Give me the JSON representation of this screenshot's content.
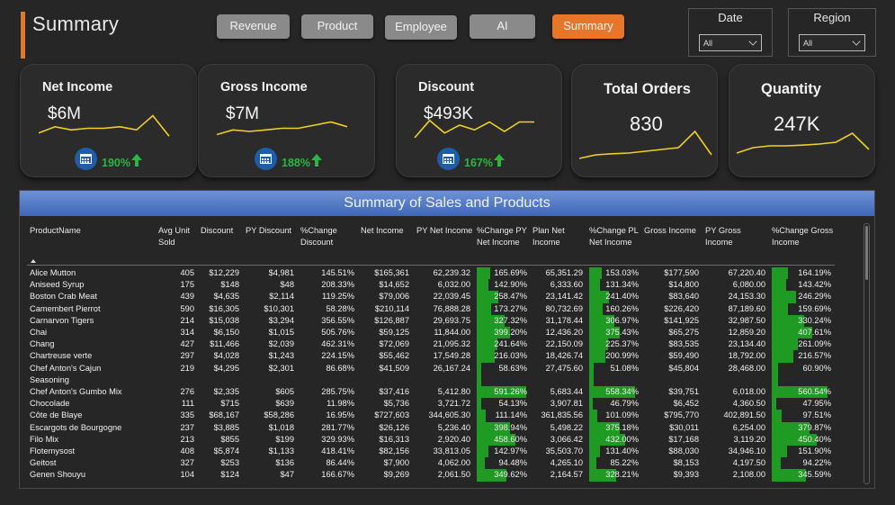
{
  "header": {
    "title": "Summary"
  },
  "nav": [
    {
      "label": "Revenue",
      "active": false
    },
    {
      "label": "Product",
      "active": false
    },
    {
      "label": "Employee",
      "active": false
    },
    {
      "label": "AI",
      "active": false
    },
    {
      "label": "Summary",
      "active": true
    }
  ],
  "slicers": {
    "date": {
      "label": "Date",
      "value": "All"
    },
    "region": {
      "label": "Region",
      "value": "All"
    }
  },
  "cards": [
    {
      "title": "Net Income",
      "value": "$6M",
      "kpi": "190%",
      "icon": "calendar-icon",
      "trend": [
        0.35,
        0.55,
        0.45,
        0.5,
        0.5,
        0.55,
        0.45,
        0.9,
        0.25
      ]
    },
    {
      "title": "Gross Income",
      "value": "$7M",
      "kpi": "188%",
      "icon": "calendar-icon",
      "trend": [
        0.3,
        0.45,
        0.4,
        0.45,
        0.5,
        0.5,
        0.6,
        0.7,
        0.55
      ]
    },
    {
      "title": "Discount",
      "value": "$493K",
      "kpi": "167%",
      "icon": "calendar-icon",
      "trend": [
        0.2,
        0.75,
        0.35,
        0.6,
        0.45,
        0.7,
        0.4,
        0.7,
        0.7
      ]
    },
    {
      "title": "Total Orders",
      "value": "830",
      "kpi": "",
      "icon": "",
      "trend": [
        0.15,
        0.25,
        0.28,
        0.3,
        0.35,
        0.4,
        0.45,
        0.9,
        0.25
      ]
    },
    {
      "title": "Quantity",
      "value": "247K",
      "kpi": "",
      "icon": "",
      "trend": [
        0.3,
        0.45,
        0.5,
        0.5,
        0.52,
        0.55,
        0.6,
        0.85,
        0.4
      ]
    }
  ],
  "table": {
    "title": "Summary of Sales and Products",
    "columns": [
      {
        "label": "ProductName"
      },
      {
        "label": "Avg Unit Sold"
      },
      {
        "label": "Discount"
      },
      {
        "label": "PY Discount"
      },
      {
        "label": "%Change Discount"
      },
      {
        "label": "Net Income"
      },
      {
        "label": "PY Net Income"
      },
      {
        "label": "%Change PY Net Income"
      },
      {
        "label": "Plan Net Income"
      },
      {
        "label": "%Change PL Net Income"
      },
      {
        "label": "Gross Income"
      },
      {
        "label": "PY Gross Income"
      },
      {
        "label": "%Change Gross Income"
      }
    ],
    "rows": [
      [
        "Alice Mutton",
        "405",
        "$12,229",
        "$4,981",
        "145.51%",
        "$165,361",
        "62,239.32",
        "165.69%",
        "65,351.29",
        "153.03%",
        "$177,590",
        "67,220.40",
        "164.19%"
      ],
      [
        "Aniseed Syrup",
        "175",
        "$148",
        "$48",
        "208.33%",
        "$14,652",
        "6,032.00",
        "142.90%",
        "6,333.60",
        "131.34%",
        "$14,800",
        "6,080.00",
        "143.42%"
      ],
      [
        "Boston Crab Meat",
        "439",
        "$4,635",
        "$2,114",
        "119.25%",
        "$79,006",
        "22,039.45",
        "258.47%",
        "23,141.42",
        "241.40%",
        "$83,640",
        "24,153.30",
        "246.29%"
      ],
      [
        "Camembert Pierrot",
        "590",
        "$16,305",
        "$10,301",
        "58.28%",
        "$210,114",
        "76,888.28",
        "173.27%",
        "80,732.69",
        "160.26%",
        "$226,420",
        "87,189.60",
        "159.69%"
      ],
      [
        "Carnarvon Tigers",
        "214",
        "$15,038",
        "$3,294",
        "356.55%",
        "$126,887",
        "29,693.75",
        "327.32%",
        "31,178.44",
        "306.97%",
        "$141,925",
        "32,987.50",
        "330.24%"
      ],
      [
        "Chai",
        "314",
        "$6,150",
        "$1,015",
        "505.76%",
        "$59,125",
        "11,844.00",
        "399.20%",
        "12,436.20",
        "375.43%",
        "$65,275",
        "12,859.20",
        "407.61%"
      ],
      [
        "Chang",
        "427",
        "$11,466",
        "$2,039",
        "462.31%",
        "$72,069",
        "21,095.32",
        "241.64%",
        "22,150.09",
        "225.37%",
        "$83,535",
        "23,134.40",
        "261.09%"
      ],
      [
        "Chartreuse verte",
        "297",
        "$4,028",
        "$1,243",
        "224.15%",
        "$55,462",
        "17,549.28",
        "216.03%",
        "18,426.74",
        "200.99%",
        "$59,490",
        "18,792.00",
        "216.57%"
      ],
      [
        "Chef Anton's Cajun Seasoning",
        "219",
        "$4,295",
        "$2,301",
        "86.68%",
        "$41,509",
        "26,167.24",
        "58.63%",
        "27,475.60",
        "51.08%",
        "$45,804",
        "28,468.00",
        "60.90%"
      ],
      [
        "Chef Anton's Gumbo Mix",
        "276",
        "$2,335",
        "$605",
        "285.75%",
        "$37,416",
        "5,412.80",
        "591.26%",
        "5,683.44",
        "558.34%",
        "$39,751",
        "6,018.00",
        "560.54%"
      ],
      [
        "Chocolade",
        "111",
        "$715",
        "$639",
        "11.98%",
        "$5,736",
        "3,721.72",
        "54.13%",
        "3,907.81",
        "46.79%",
        "$6,452",
        "4,360.50",
        "47.95%"
      ],
      [
        "Côte de Blaye",
        "335",
        "$68,167",
        "$58,286",
        "16.95%",
        "$727,603",
        "344,605.30",
        "111.14%",
        "361,835.56",
        "101.09%",
        "$795,770",
        "402,891.50",
        "97.51%"
      ],
      [
        "Escargots de Bourgogne",
        "237",
        "$3,885",
        "$1,018",
        "281.77%",
        "$26,126",
        "5,236.40",
        "398.94%",
        "5,498.22",
        "375.18%",
        "$30,011",
        "6,254.00",
        "379.87%"
      ],
      [
        "Filo Mix",
        "213",
        "$855",
        "$199",
        "329.93%",
        "$16,313",
        "2,920.40",
        "458.60%",
        "3,066.42",
        "432.00%",
        "$17,168",
        "3,119.20",
        "450.40%"
      ],
      [
        "Flotemysost",
        "408",
        "$5,874",
        "$1,133",
        "418.41%",
        "$82,156",
        "33,813.05",
        "142.97%",
        "35,503.70",
        "131.40%",
        "$88,030",
        "34,946.10",
        "151.90%"
      ],
      [
        "Geitost",
        "327",
        "$253",
        "$136",
        "86.44%",
        "$7,900",
        "4,062.00",
        "94.48%",
        "4,265.10",
        "85.22%",
        "$8,153",
        "4,197.50",
        "94.22%"
      ],
      [
        "Genen Shouyu",
        "104",
        "$124",
        "$47",
        "166.67%",
        "$9,269",
        "2,061.50",
        "349.62%",
        "2,164.57",
        "328.21%",
        "$9,393",
        "2,108.00",
        "345.59%"
      ]
    ]
  }
}
